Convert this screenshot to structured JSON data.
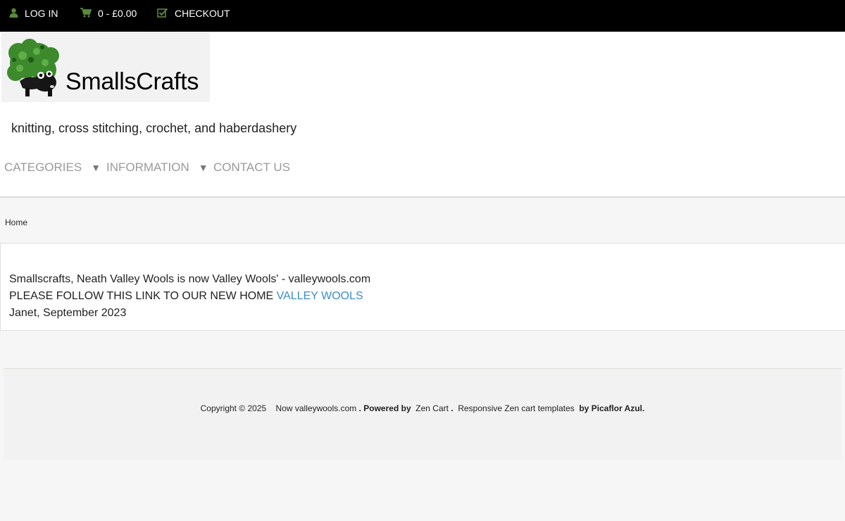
{
  "topbar": {
    "login_label": "LOG IN",
    "login_icon": "user-icon",
    "cart_label": "0 - £0.00",
    "cart_icon": "cart-icon",
    "checkout_label": "CHECKOUT",
    "checkout_icon": "checkbox-icon",
    "icon_color": "#5a8a3a"
  },
  "header": {
    "logo_text": "SmallsCrafts",
    "tagline": "knitting, cross stitching, crochet, and haberdashery"
  },
  "nav": {
    "categories": "CATEGORIES",
    "information": "INFORMATION",
    "contact": "CONTACT US",
    "caret": "▼"
  },
  "breadcrumb": {
    "home": "Home"
  },
  "content": {
    "line1": "Smallscrafts, Neath Valley Wools is now Valley Wools' - valleywools.com",
    "line2_prefix": "PLEASE FOLLOW THIS LINK TO OUR NEW HOME",
    "line2_link": "VALLEY WOOLS",
    "line3": "Janet, September 2023",
    "link_color": "#3b8ec6"
  },
  "footer": {
    "copyright": "Copyright © 2025",
    "site": "Now valleywools.com",
    "powered_by": ". Powered by",
    "zen_cart": "Zen Cart",
    "dot": ".",
    "templates": "Responsive Zen cart templates",
    "by": "by Picaflor Azul."
  }
}
